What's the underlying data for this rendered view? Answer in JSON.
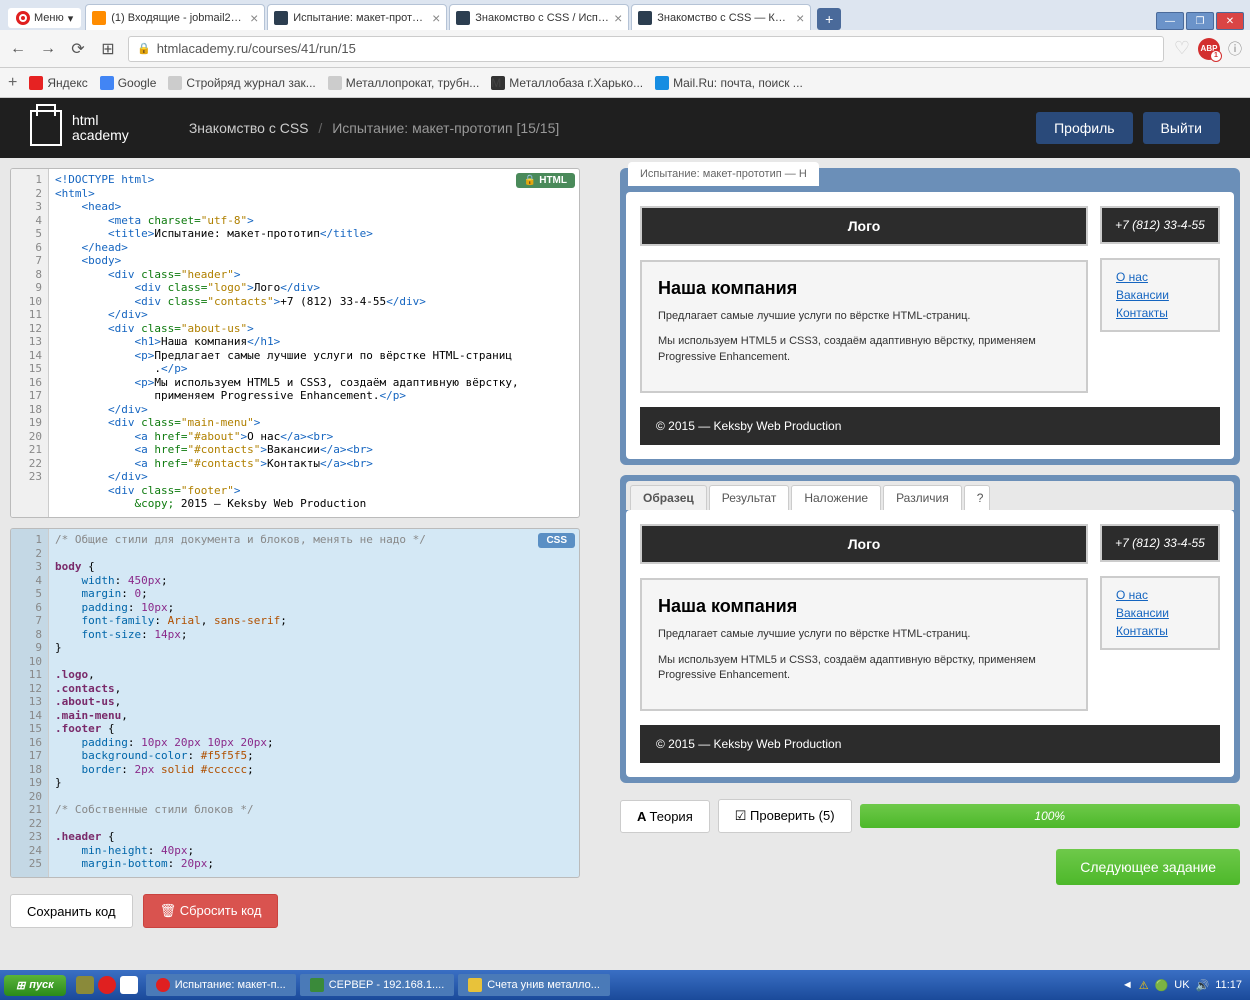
{
  "opera": {
    "menu": "Меню"
  },
  "tabs": [
    {
      "title": "(1) Входящие - jobmail2001@..."
    },
    {
      "title": "Испытание: макет-прототи..."
    },
    {
      "title": "Знакомство с CSS / Испытан..."
    },
    {
      "title": "Знакомство с CSS — Курсы..."
    }
  ],
  "url": "htmlacademy.ru/courses/41/run/15",
  "bookmarks": [
    {
      "label": "Яндекс"
    },
    {
      "label": "Google"
    },
    {
      "label": "Стройряд журнал зак..."
    },
    {
      "label": "Металлопрокат, трубн..."
    },
    {
      "label": "Металлобаза г.Харько..."
    },
    {
      "label": "Mail.Ru: почта, поиск ..."
    }
  ],
  "header": {
    "logo1": "html",
    "logo2": "academy",
    "bc_course": "Знакомство с CSS",
    "bc_task": "Испытание: макет-прототип [15/15]",
    "profile": "Профиль",
    "logout": "Выйти"
  },
  "editor": {
    "html_badge": "HTML",
    "css_badge": "CSS",
    "html_lines": [
      "1",
      "2",
      "3",
      "4",
      "5",
      "6",
      "7",
      "8",
      "9",
      "10",
      "11",
      "12",
      "13",
      "14",
      "15",
      "16",
      "17",
      "18",
      "19",
      "20",
      "21",
      "22",
      "23"
    ],
    "css_lines": [
      "1",
      "2",
      "3",
      "4",
      "5",
      "6",
      "7",
      "8",
      "9",
      "10",
      "11",
      "12",
      "13",
      "14",
      "15",
      "16",
      "17",
      "18",
      "19",
      "20",
      "21",
      "22",
      "23",
      "24",
      "25"
    ]
  },
  "preview": {
    "tab_label": "Испытание: макет-прототип — H",
    "logo": "Лого",
    "phone": "+7 (812) 33-4-55",
    "h1": "Наша компания",
    "p1": "Предлагает самые лучшие услуги по вёрстке HTML-страниц.",
    "p2": "Мы используем HTML5 и CSS3, создаём адаптивную вёрстку, применяем Progressive Enhancement.",
    "link1": "О нас",
    "link2": "Вакансии",
    "link3": "Контакты",
    "footer": "© 2015 — Keksby Web Production"
  },
  "result_tabs": {
    "sample": "Образец",
    "result": "Результат",
    "overlay": "Наложение",
    "diff": "Различия",
    "help": "?"
  },
  "actions": {
    "save": "Сохранить код",
    "reset": "Сбросить код",
    "theory": "Теория",
    "check": "Проверить (5)",
    "progress": "100%",
    "next": "Следующее задание"
  },
  "taskbar": {
    "start": "пуск",
    "items": [
      {
        "label": "Испытание: макет-п..."
      },
      {
        "label": "СЕРВЕР - 192.168.1...."
      },
      {
        "label": "Счета унив металло..."
      }
    ],
    "lang": "UK",
    "time": "11:17"
  }
}
